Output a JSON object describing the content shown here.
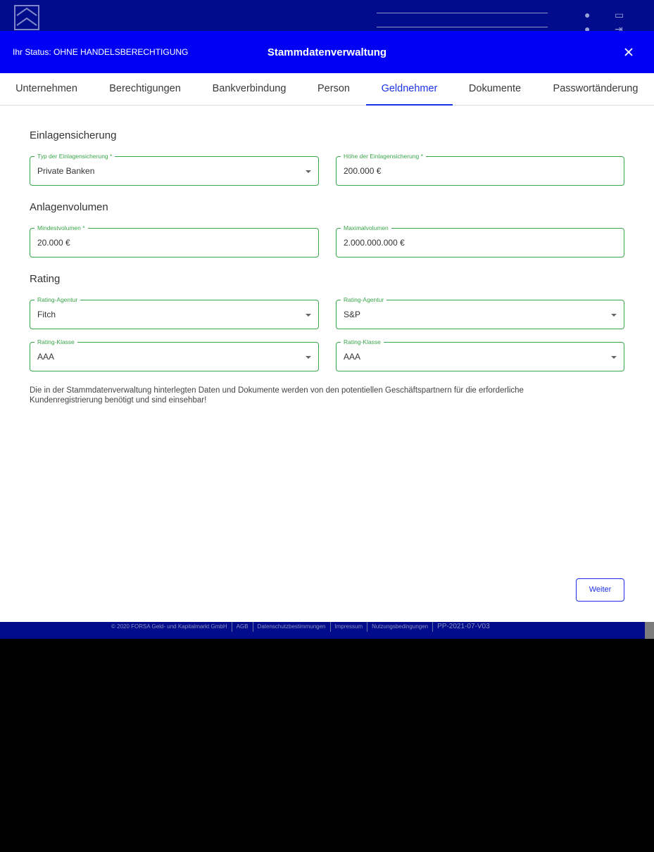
{
  "background": {
    "brand_text": "FORSA ... ..."
  },
  "header": {
    "status": "Ihr Status: OHNE HANDELSBERECHTIGUNG",
    "title": "Stammdatenverwaltung",
    "close_icon": "close-icon"
  },
  "tabs": [
    {
      "label": "Unternehmen",
      "active": false
    },
    {
      "label": "Berechtigungen",
      "active": false
    },
    {
      "label": "Bankverbindung",
      "active": false
    },
    {
      "label": "Person",
      "active": false
    },
    {
      "label": "Geldnehmer",
      "active": true
    },
    {
      "label": "Dokumente",
      "active": false
    },
    {
      "label": "Passwortänderung",
      "active": false
    }
  ],
  "sections": {
    "einlagensicherung": {
      "title": "Einlagensicherung",
      "typ": {
        "label": "Typ der Einlagensicherung *",
        "value": "Private Banken"
      },
      "hoehe": {
        "label": "Höhe der Einlagensicherung *",
        "value": "200.000 €"
      }
    },
    "anlagenvolumen": {
      "title": "Anlagenvolumen",
      "min": {
        "label": "Mindestvolumen *",
        "value": "20.000 €"
      },
      "max": {
        "label": "Maximalvolumen",
        "value": "2.000.000.000 €"
      }
    },
    "rating": {
      "title": "Rating",
      "agentur_left": {
        "label": "Rating-Agentur",
        "value": "Fitch"
      },
      "agentur_right": {
        "label": "Rating-Agentur",
        "value": "S&P"
      },
      "klasse_left": {
        "label": "Rating-Klasse",
        "value": "AAA"
      },
      "klasse_right": {
        "label": "Rating-Klasse",
        "value": "AAA"
      }
    }
  },
  "info_text": "Die in der Stammdatenverwaltung hinterlegten Daten und Dokumente werden von den potentiellen Geschäftspartnern für die erforderliche Kundenregistrierung benötigt und sind einsehbar!",
  "weiter_label": "Weiter",
  "footer": {
    "copyright": "© 2020 FORSA Geld- und Kapitalmarkt GmbH",
    "agb": "AGB",
    "datenschutz": "Datenschutzbestimmungen",
    "impressum": "Impressum",
    "nutzung": "Nutzungsbedingungen",
    "version": "PP-2021-07-V03"
  },
  "colors": {
    "header_bg": "#0000f5",
    "accent": "#1c31e6",
    "field_border": "#3aa64a",
    "footer_bg": "#000c8c"
  }
}
